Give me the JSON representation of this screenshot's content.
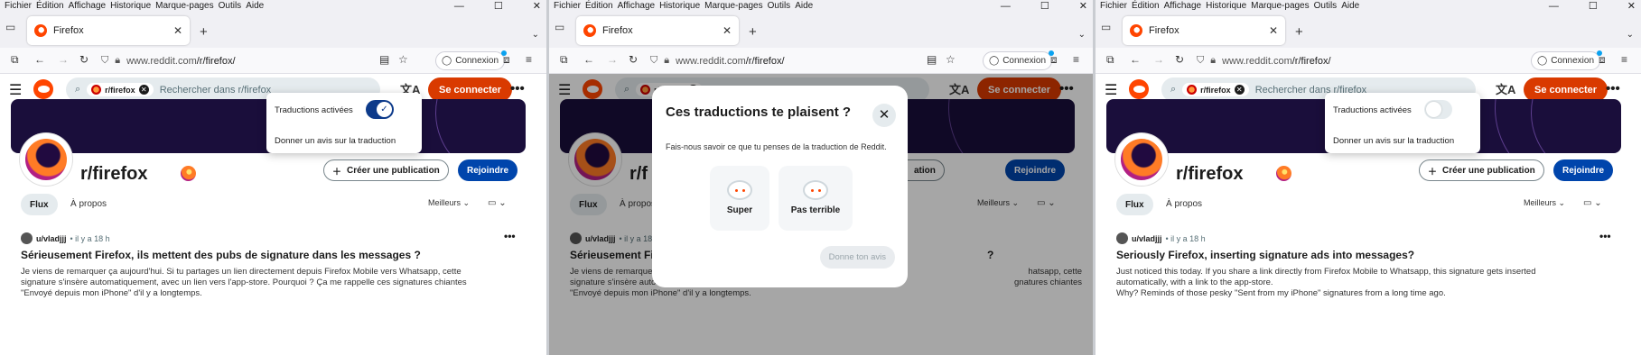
{
  "menu": [
    "Fichier",
    "Édition",
    "Affichage",
    "Historique",
    "Marque-pages",
    "Outils",
    "Aide"
  ],
  "window_controls": [
    "—",
    "☐",
    "✕"
  ],
  "tab": {
    "title": "Firefox",
    "close": "✕",
    "new": "+"
  },
  "nav": {
    "back": "←",
    "forward": "→",
    "reload": "↻",
    "url_domain": "www.reddit.com",
    "url_path": "/r/firefox/",
    "connexion": "Connexion",
    "menu": "≡"
  },
  "reddit": {
    "search_chip": "r/firefox",
    "search_placeholder": "Rechercher dans r/firefox",
    "connect": "Se connecter",
    "translate_icon": "文A",
    "more": "•••",
    "sub_name": "r/firefox",
    "create_post": "Créer une publication",
    "join": "Rejoindre",
    "tab_flux": "Flux",
    "tab_about": "À propos",
    "sort": "Meilleurs",
    "author": "u/vladjjj",
    "time": "• il y a 18 h"
  },
  "popover": {
    "toggle_label": "Traductions activées",
    "feedback": "Donner un avis sur la traduction"
  },
  "modal": {
    "title": "Ces traductions te plaisent ?",
    "subtitle": "Fais-nous savoir ce que tu penses de la traduction de Reddit.",
    "option1": "Super",
    "option2": "Pas terrible",
    "submit": "Donne ton avis"
  },
  "post_fr": {
    "title": "Sérieusement Firefox, ils mettent des pubs de signature dans les messages ?",
    "line1": "Je viens de remarquer ça aujourd'hui. Si tu partages un lien directement depuis Firefox Mobile vers Whatsapp, cette",
    "line2": "signature s'insère automatiquement, avec un lien vers l'app-store. Pourquoi ? Ça me rappelle ces signatures chiantes",
    "line3": "\"Envoyé depuis mon iPhone\" d'il y a longtemps."
  },
  "post_fr_mid": {
    "title": "Sérieusement Fire",
    "title_tail": "?",
    "line1a": "Je viens de remarquer ç",
    "line1b": "hatsapp, cette",
    "line2a": "signature s'insère automatiquement, avec",
    "line2b": "gnatures chiantes",
    "line3": "\"Envoyé depuis mon iPhone\" d'il y a longtemps.",
    "create_tail": "ation",
    "sub_tail": "r/f"
  },
  "post_en": {
    "title": "Seriously Firefox, inserting signature ads into messages?",
    "line1": "Just noticed this today. If you share a link directly from Firefox Mobile to Whatsapp, this signature gets inserted",
    "line2": "automatically, with a link to the app-store.",
    "line3": "Why? Reminds of those pesky \"Sent from my iPhone\" signatures from a long time ago."
  },
  "colors": {
    "reddit_orange": "#ff4500",
    "connect_bg": "#d93a00",
    "join_bg": "#0045ac",
    "toggle_on": "#0d3a8a",
    "banner": "#1a0e3b"
  },
  "icons": [
    "sidebar-icon",
    "back-icon",
    "forward-icon",
    "reload-icon",
    "shield-icon",
    "lock-icon",
    "reader-icon",
    "bookmark-star-icon",
    "extension-icon",
    "hamburger-icon",
    "search-icon",
    "translate-icon",
    "firefox-icon",
    "plus-icon",
    "sort-chevron-icon",
    "view-icon",
    "close-icon",
    "snoo-icon"
  ]
}
